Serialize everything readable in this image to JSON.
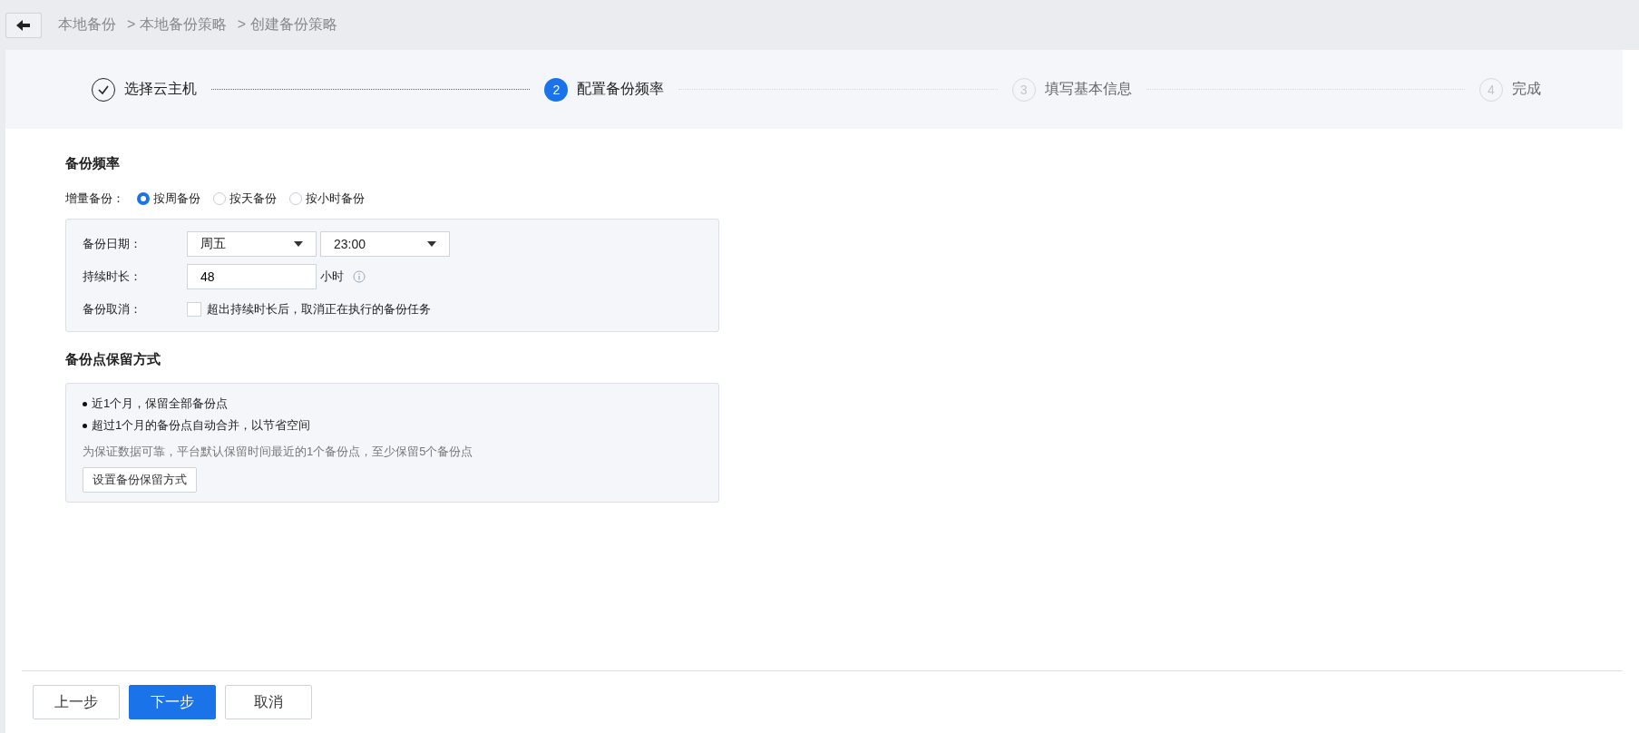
{
  "breadcrumb": [
    "本地备份",
    "> 本地备份策略",
    "> 创建备份策略"
  ],
  "steps": [
    {
      "label": "选择云主机",
      "kind": "done"
    },
    {
      "number": "2",
      "label": "配置备份频率",
      "kind": "active"
    },
    {
      "number": "3",
      "label": "填写基本信息",
      "kind": "pending"
    },
    {
      "number": "4",
      "label": "完成",
      "kind": "pending"
    }
  ],
  "frequency": {
    "title": "备份频率",
    "label": "增量备份：",
    "options": [
      {
        "label": "按周备份",
        "selected": true
      },
      {
        "label": "按天备份",
        "selected": false
      },
      {
        "label": "按小时备份",
        "selected": false
      }
    ],
    "date_label": "备份日期：",
    "day": "周五",
    "time": "23:00",
    "duration_label": "持续时长：",
    "duration": "48",
    "duration_unit": "小时",
    "cancel_label": "备份取消：",
    "cancel_text": "超出持续时长后，取消正在执行的备份任务",
    "cancel_checked": false
  },
  "retention": {
    "title": "备份点保留方式",
    "bullets": [
      "近1个月，保留全部备份点",
      "超过1个月的备份点自动合并，以节省空间"
    ],
    "note": "为保证数据可靠，平台默认保留时间最近的1个备份点，至少保留5个备份点",
    "button": "设置备份保留方式"
  },
  "footer": {
    "buttons": [
      {
        "label": "上一步",
        "kind": "default"
      },
      {
        "label": "下一步",
        "kind": "primary"
      },
      {
        "label": "取消",
        "kind": "default"
      }
    ]
  }
}
